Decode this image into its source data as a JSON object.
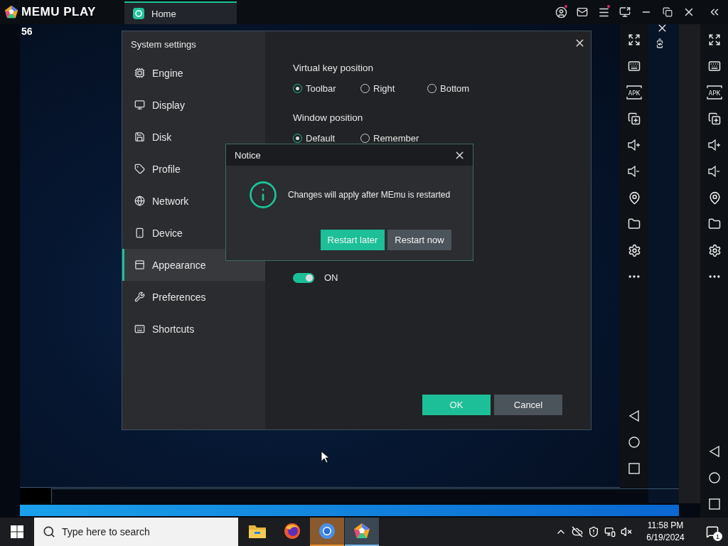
{
  "top_bar": {
    "logo": "MEMU PLAY",
    "tabs": [
      {
        "label": "Home",
        "selected": true
      }
    ]
  },
  "side_counter": "56",
  "toolbars": [
    {
      "apk_label": "APK"
    },
    {
      "apk_label": "APK"
    }
  ],
  "settings": {
    "title": "System settings",
    "sidebar": [
      {
        "label": "Engine",
        "selected": false
      },
      {
        "label": "Display",
        "selected": false
      },
      {
        "label": "Disk",
        "selected": false
      },
      {
        "label": "Profile",
        "selected": false
      },
      {
        "label": "Network",
        "selected": false
      },
      {
        "label": "Device",
        "selected": false
      },
      {
        "label": "Appearance",
        "selected": true
      },
      {
        "label": "Preferences",
        "selected": false
      },
      {
        "label": "Shortcuts",
        "selected": false
      }
    ],
    "sections": [
      {
        "label": "Virtual key position",
        "options": [
          {
            "label": "Toolbar",
            "selected": true
          },
          {
            "label": "Right",
            "selected": false
          },
          {
            "label": "Bottom",
            "selected": false
          }
        ]
      },
      {
        "label": "Window position",
        "options": [
          {
            "label": "Default",
            "selected": true
          },
          {
            "label": "Remember",
            "selected": false
          }
        ]
      }
    ],
    "zoom": {
      "on": true,
      "state_label": "ON"
    },
    "buttons": [
      {
        "label": "OK",
        "kind": "primary"
      },
      {
        "label": "Cancel",
        "kind": "secondary"
      }
    ]
  },
  "notice": {
    "title": "Notice",
    "message": "Changes will apply after MEmu is restarted",
    "buttons": [
      {
        "label": "Restart later",
        "kind": "primary"
      },
      {
        "label": "Restart now",
        "kind": "secondary"
      }
    ]
  },
  "taskbar": {
    "search": {
      "placeholder": "Type here to search"
    },
    "apps": [
      {
        "open": false,
        "selected": false
      },
      {
        "open": false,
        "selected": false
      },
      {
        "open": true,
        "selected": false
      },
      {
        "open": true,
        "selected": true
      }
    ],
    "time": "11:58 PM",
    "date": "6/19/2024",
    "notification_count": "1"
  }
}
